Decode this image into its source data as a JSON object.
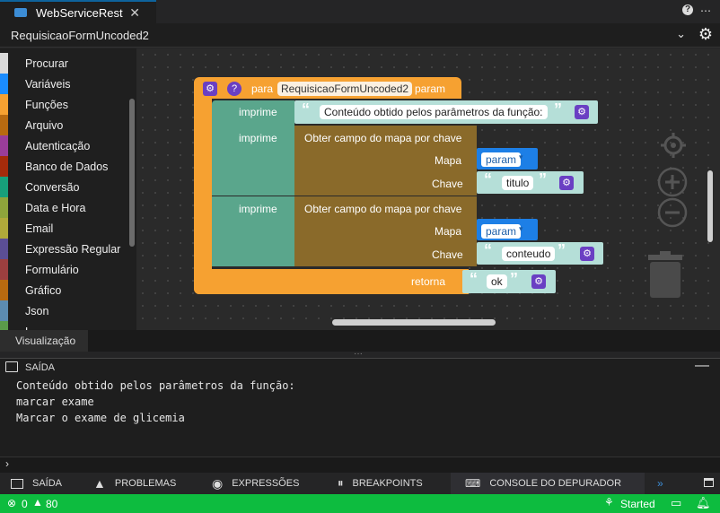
{
  "tabbar": {
    "tab_label": "WebServiceRest",
    "close": "✕",
    "help": "?",
    "more": "⋯"
  },
  "header": {
    "title": "RequisicaoFormUncoded2",
    "chevron": "⌄",
    "gear": "⚙"
  },
  "toolbox": {
    "items": [
      {
        "label": "Procurar",
        "color": "#d9d9d9"
      },
      {
        "label": "Variáveis",
        "color": "#1a8cff"
      },
      {
        "label": "Funções",
        "color": "#f6a131"
      },
      {
        "label": "Arquivo",
        "color": "#b86a10"
      },
      {
        "label": "Autenticação",
        "color": "#9a3d99"
      },
      {
        "label": "Banco de Dados",
        "color": "#a52b0b"
      },
      {
        "label": "Conversão",
        "color": "#17a07a"
      },
      {
        "label": "Data e Hora",
        "color": "#8ea43b"
      },
      {
        "label": "Email",
        "color": "#b0a93a"
      },
      {
        "label": "Expressão Regular",
        "color": "#5b4e95"
      },
      {
        "label": "Formulário",
        "color": "#9c3f3f"
      },
      {
        "label": "Gráfico",
        "color": "#b86a10"
      },
      {
        "label": "Json",
        "color": "#5c8bb0"
      },
      {
        "label": "L",
        "color": "#5a9a4a"
      }
    ]
  },
  "blocks": {
    "func_keyword": "para",
    "func_name": "RequisicaoFormUncoded2",
    "func_param": "param",
    "print_label": "imprime",
    "print1_text": "Conteúdo obtido pelos parâmetros da função:",
    "map_label": "Obter campo do mapa por chave",
    "map_input": "Mapa",
    "key_input": "Chave",
    "var1": "param",
    "key1": "titulo",
    "var2": "param",
    "key2": "conteudo",
    "return_label": "retorna",
    "return_value": "ok",
    "open_quote": "“",
    "close_quote": "”"
  },
  "viz_tab": "Visualização",
  "output": {
    "title": "SAÍDA",
    "lines": [
      "Conteúdo obtido pelos parâmetros da função:",
      "marcar exame",
      "Marcar o exame de glicemia"
    ],
    "prompt": "›"
  },
  "bottom_tabs": [
    {
      "label": "SAÍDA",
      "icon": "terminal-icon"
    },
    {
      "label": "PROBLEMAS",
      "icon": "warning-icon"
    },
    {
      "label": "EXPRESSÕES",
      "icon": "eye-icon"
    },
    {
      "label": "BREAKPOINTS",
      "icon": "pause-icon"
    },
    {
      "label": "CONSOLE DO DEPURADOR",
      "icon": "console-icon"
    }
  ],
  "status": {
    "errors": "0",
    "warnings": "80",
    "state": "Started"
  },
  "colors": {
    "accent": "#0e639c",
    "status_bar": "#0dbc3f",
    "function_block": "#f6a131",
    "print_block": "#5aa68c",
    "map_block": "#8a6a2a",
    "variable_block": "#1d7fe6",
    "text_block": "#b5dfd8",
    "mutator": "#6a3fc3"
  }
}
